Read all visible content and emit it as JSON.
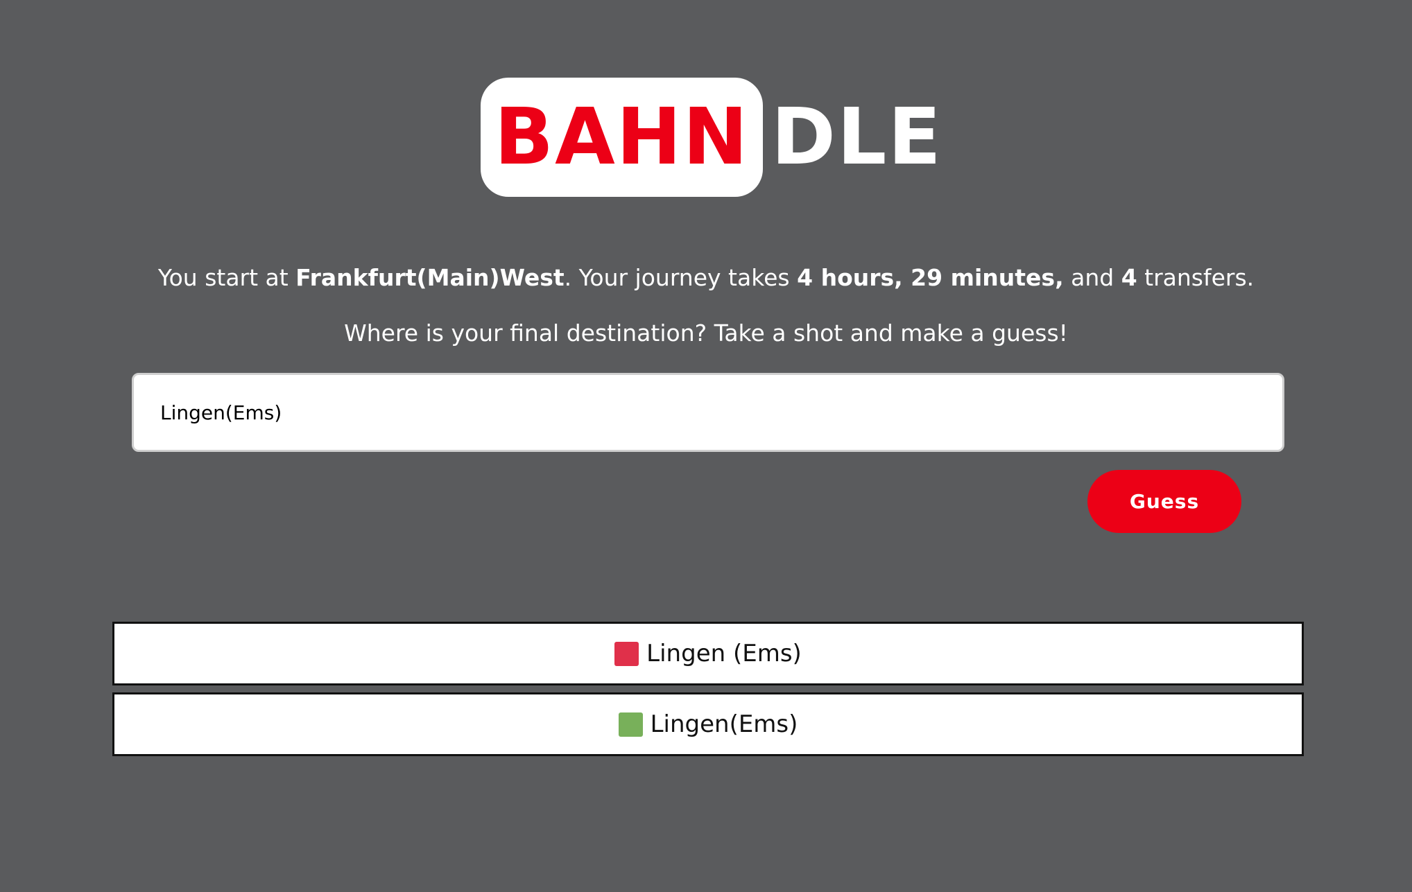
{
  "logo": {
    "part1": "BAHN",
    "part2": "DLE",
    "accent_color": "#ec0016"
  },
  "intro": {
    "prefix": "You start at ",
    "station": "Frankfurt(Main)West",
    "mid1": ". Your journey takes ",
    "duration": "4 hours, 29 minutes,",
    "mid2": " and ",
    "transfers": "4",
    "suffix": " transfers."
  },
  "question": "Where is your final destination? Take a shot and make a guess!",
  "input": {
    "value": "Lingen(Ems)",
    "placeholder": ""
  },
  "guess_button": {
    "label": "Guess"
  },
  "guesses": [
    {
      "label": "Lingen (Ems)",
      "status": "wrong",
      "color": "#e0304a"
    },
    {
      "label": "Lingen(Ems)",
      "status": "correct",
      "color": "#78b05a"
    }
  ]
}
